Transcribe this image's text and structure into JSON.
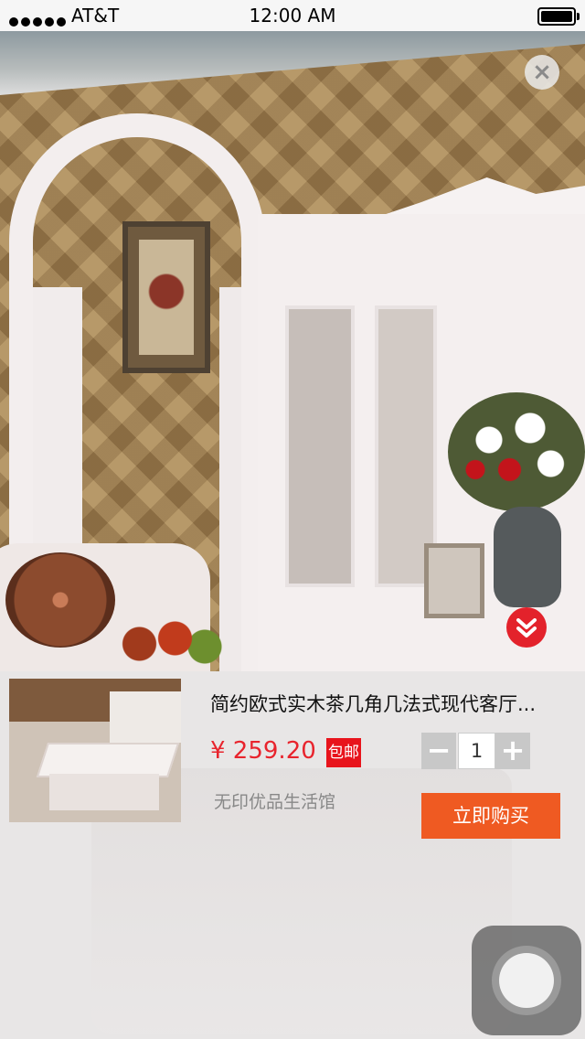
{
  "status_bar": {
    "carrier": "AT&T",
    "time": "12:00 AM",
    "signal_icon": "signal-dots-icon",
    "battery_icon": "battery-full-icon"
  },
  "hero": {
    "image_subject": "product-photo",
    "close_icon": "close-icon",
    "collapse_icon": "chevron-down-icon",
    "accent_color": "#e3222b"
  },
  "product": {
    "title": "简约欧式实木茶几角几法式现代客厅...",
    "price": "¥ 259.20",
    "badge": "包邮",
    "shop": "无印优品生活馆",
    "quantity": {
      "minus_label": "−",
      "value": "1",
      "plus_label": "+"
    },
    "buy_label": "立即购买",
    "price_color": "#e8242d",
    "buy_color": "#ef5a22"
  },
  "assistive_touch": {
    "icon": "assistive-touch-icon"
  }
}
